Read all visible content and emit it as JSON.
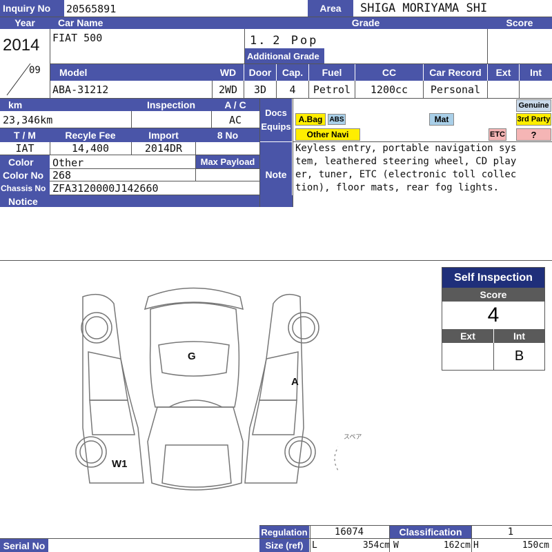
{
  "sheet": {
    "inquiry_label": "Inquiry No",
    "inquiry_value": "20565891",
    "area_label": "Area",
    "area_value": "SHIGA MORIYAMA SHI",
    "year_label": "Year",
    "year_value": "2014",
    "month_value": "09",
    "car_name_label": "Car Name",
    "car_name_value": "FIAT 500",
    "grade_label": "Grade",
    "grade_value": "1．2 Pop",
    "additional_grade_label": "Additional Grade",
    "additional_grade_value": "",
    "score_label": "Score",
    "score_value": "",
    "model_label": "Model",
    "model_value": "ABA-31212",
    "wd_label": "WD",
    "wd_value": "2WD",
    "door_label": "Door",
    "door_value": "3D",
    "cap_label": "Cap.",
    "cap_value": "4",
    "fuel_label": "Fuel",
    "fuel_value": "Petrol",
    "cc_label": "CC",
    "cc_value": "1200cc",
    "car_record_label": "Car Record",
    "car_record_value": "Personal",
    "ext_label": "Ext",
    "ext_value": "",
    "int_label": "Int",
    "int_value": "",
    "km_label": "km",
    "km_value": "23,346km",
    "inspection_label": "Inspection",
    "inspection_value": "",
    "ac_label": "A / C",
    "ac_value": "AC",
    "docs_label": "Docs",
    "equips_label": "Equips",
    "tm_label": "T / M",
    "tm_value": "IAT",
    "recycle_label": "Recyle Fee",
    "recycle_value": "14,400",
    "import_label": "Import",
    "import_value": "2014DR",
    "eightno_label": "8 No",
    "eightno_value": "",
    "color_label": "Color",
    "color_value": "Other",
    "colorno_label": "Color No",
    "colorno_value": "268",
    "maxpayload_label": "Max Payload",
    "maxpayload_value": "",
    "chassis_label": "Chassis No",
    "chassis_value": "ZFA3120000J142660",
    "notice_label": "Notice",
    "note_label": "Note",
    "note_lines": [
      "Keyless entry, portable navigation sys",
      "tem, leathered steering wheel, CD play",
      "er, tuner, ETC (electronic toll collec",
      "tion), floor mats, rear fog lights."
    ]
  },
  "equips": {
    "abag": "A.Bag",
    "abs": "ABS",
    "mat": "Mat",
    "other_navi": "Other Navi",
    "etc": "ETC",
    "genuine": "Genuine",
    "third_party": "3rd Party",
    "question": "?"
  },
  "colors": {
    "header_blue": "#4a55a8",
    "dark_blue": "#1f2f7a",
    "gray_header": "#5a5a5a",
    "yellow": "#ffee00",
    "light_blue": "#a9cfe8",
    "pink": "#f5b5b5"
  },
  "diagram": {
    "marks": [
      "G",
      "A",
      "W1"
    ],
    "spare_label": "スペア"
  },
  "self_inspection": {
    "title": "Self Inspection",
    "score_label": "Score",
    "score_value": "4",
    "ext_label": "Ext",
    "int_label": "Int",
    "ext_value": "",
    "int_value": "B"
  },
  "footer": {
    "regulation_label": "Regulation",
    "regulation_value": "16074",
    "classification_label": "Classification",
    "classification_value": "1",
    "size_label": "Size (ref)",
    "l_label": "L",
    "l_value": "354cm",
    "w_label": "W",
    "w_value": "162cm",
    "h_label": "H",
    "h_value": "150cm",
    "serial_label": "Serial No"
  }
}
